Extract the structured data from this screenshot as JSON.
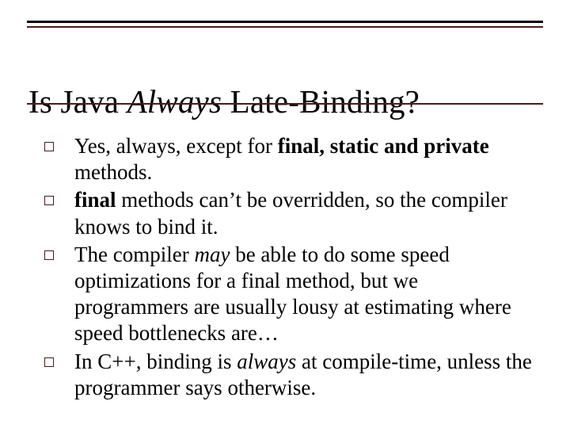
{
  "title": {
    "pre": "Is Java ",
    "em": "Always",
    "post": " Late-Binding?"
  },
  "bullets": [
    {
      "html": "Yes, always, except for <b>final, static and private</b> methods."
    },
    {
      "html": "<b>final</b> methods can’t be overridden, so the compiler knows to bind it."
    },
    {
      "html": "The compiler <i>may</i> be able to do some speed optimizations for a final method, but we programmers are usually lousy at estimating where speed bottlenecks are…"
    },
    {
      "html": "In C++, binding is <i>always</i> at compile-time, unless the programmer says otherwise."
    }
  ]
}
